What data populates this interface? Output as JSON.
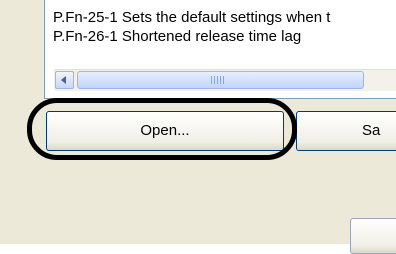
{
  "list": {
    "items": [
      {
        "label": "P.Fn-25-1 Sets the default settings when t"
      },
      {
        "label": "P.Fn-26-1 Shortened release time lag"
      }
    ]
  },
  "buttons": {
    "open_label": "Open...",
    "save_label": "Sa"
  }
}
